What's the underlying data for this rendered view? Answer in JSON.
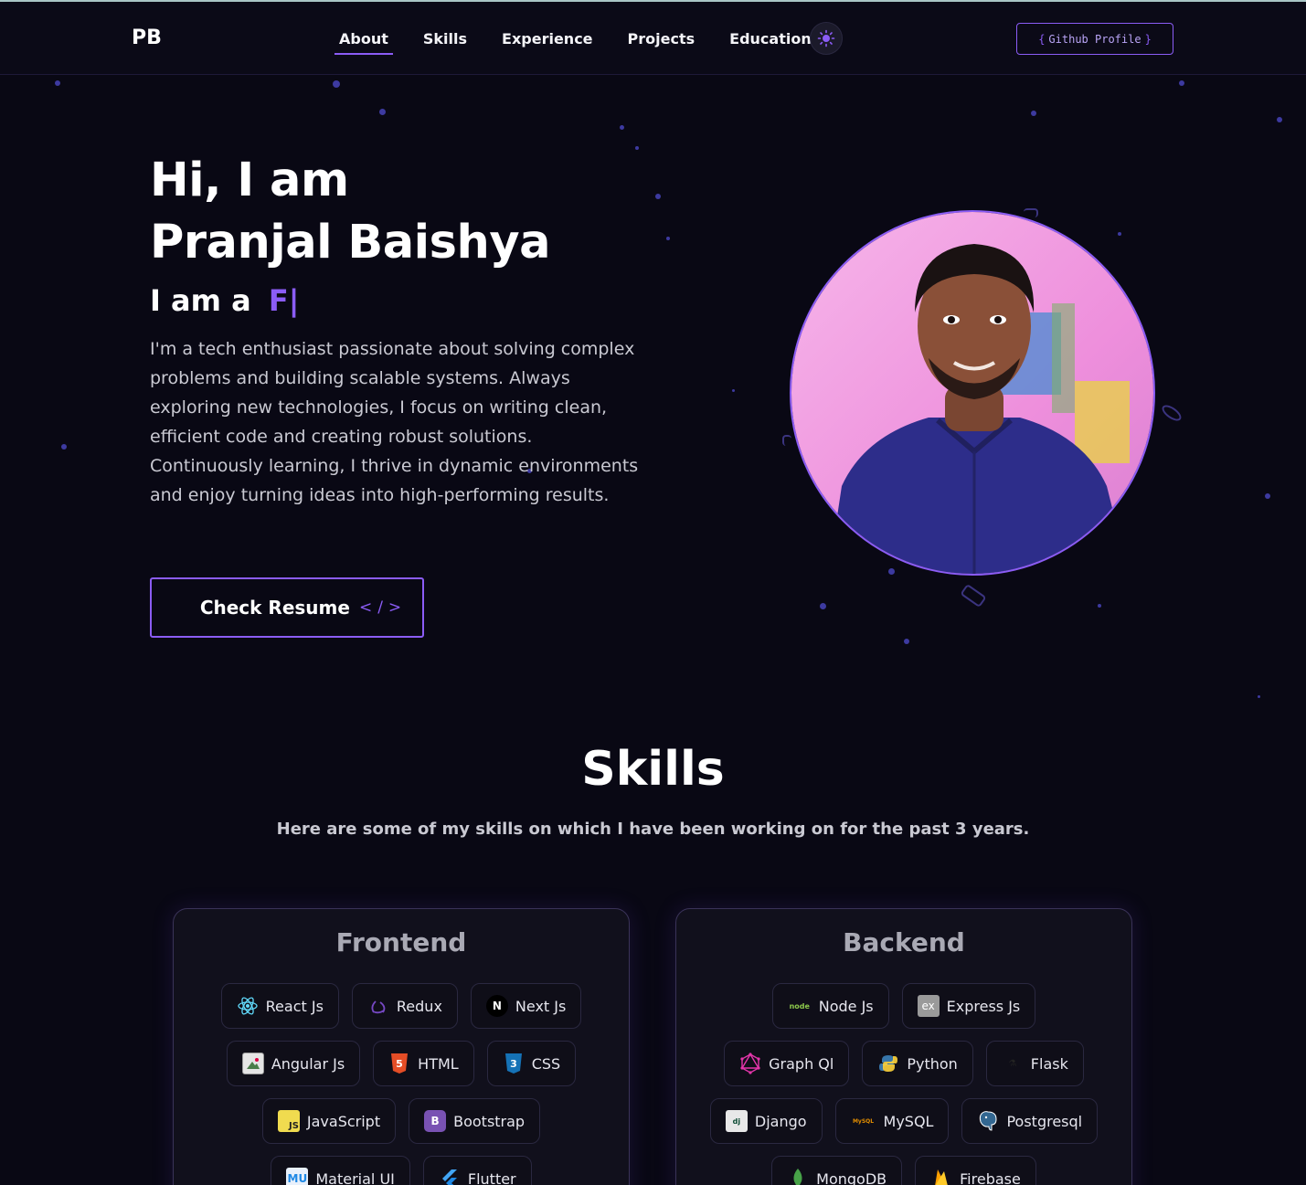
{
  "nav": {
    "logo": "PB",
    "links": [
      "About",
      "Skills",
      "Experience",
      "Projects",
      "Education"
    ],
    "active": "About",
    "github_label": "Github Profile",
    "github_open": "{",
    "github_close": "}"
  },
  "hero": {
    "greeting": "Hi, I am",
    "name": "Pranjal Baishya",
    "role_prefix": "I am a",
    "role_typed": "F|",
    "description": "I'm a tech enthusiast passionate about solving complex problems and building scalable systems. Always exploring new technologies, I focus on writing clean, efficient code and creating robust solutions. Continuously learning, I thrive in dynamic environments and enjoy turning ideas into high-performing results.",
    "resume_label": "Check Resume",
    "resume_code": "</>"
  },
  "skills": {
    "title": "Skills",
    "subtitle": "Here are some of my skills on which I have been working on for the past 3 years.",
    "frontend": {
      "title": "Frontend",
      "rows": [
        [
          {
            "label": "React Js",
            "icon": "react-icon"
          },
          {
            "label": "Redux",
            "icon": "redux-icon"
          },
          {
            "label": "Next Js",
            "icon": "nextjs-icon"
          }
        ],
        [
          {
            "label": "Angular Js",
            "icon": "angular-icon"
          },
          {
            "label": "HTML",
            "icon": "html-icon"
          },
          {
            "label": "CSS",
            "icon": "css-icon"
          }
        ],
        [
          {
            "label": "JavaScript",
            "icon": "javascript-icon"
          },
          {
            "label": "Bootstrap",
            "icon": "bootstrap-icon"
          }
        ],
        [
          {
            "label": "Material UI",
            "icon": "material-ui-icon"
          },
          {
            "label": "Flutter",
            "icon": "flutter-icon"
          }
        ]
      ]
    },
    "backend": {
      "title": "Backend",
      "rows": [
        [
          {
            "label": "Node Js",
            "icon": "nodejs-icon"
          },
          {
            "label": "Express Js",
            "icon": "express-icon"
          }
        ],
        [
          {
            "label": "Graph Ql",
            "icon": "graphql-icon"
          },
          {
            "label": "Python",
            "icon": "python-icon"
          },
          {
            "label": "Flask",
            "icon": "flask-icon"
          }
        ],
        [
          {
            "label": "Django",
            "icon": "django-icon"
          },
          {
            "label": "MySQL",
            "icon": "mysql-icon"
          },
          {
            "label": "Postgresql",
            "icon": "postgresql-icon"
          }
        ],
        [
          {
            "label": "MongoDB",
            "icon": "mongodb-icon"
          },
          {
            "label": "Firebase",
            "icon": "firebase-icon"
          }
        ]
      ]
    }
  },
  "colors": {
    "accent": "#8b5cf6",
    "background": "#090814"
  }
}
